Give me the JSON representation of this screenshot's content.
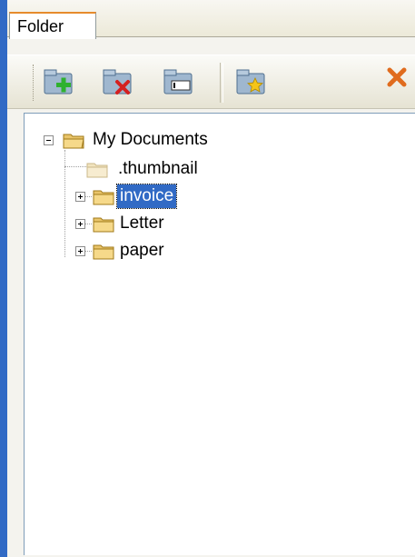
{
  "panel": {
    "tab_label": "Folder"
  },
  "toolbar": {
    "buttons": [
      {
        "icon": "new-folder-icon"
      },
      {
        "icon": "delete-folder-icon"
      },
      {
        "icon": "rename-folder-icon"
      },
      {
        "icon": "favorite-folder-icon"
      }
    ],
    "close_icon": "close-icon"
  },
  "tree": {
    "root": {
      "label": "My Documents",
      "expanded": true
    },
    "children": [
      {
        "label": ".thumbnail",
        "expandable": false,
        "selected": false
      },
      {
        "label": "invoice",
        "expandable": true,
        "selected": true
      },
      {
        "label": "Letter",
        "expandable": true,
        "selected": false
      },
      {
        "label": "paper",
        "expandable": true,
        "selected": false
      }
    ]
  },
  "colors": {
    "selection": "#316ac5",
    "accent_edge": "#316ac5",
    "tab_highlight": "#e68b2c"
  }
}
